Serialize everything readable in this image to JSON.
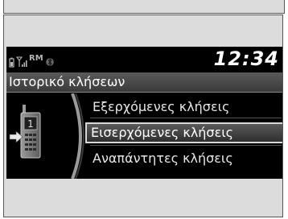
{
  "status": {
    "roaming_label": "RM",
    "clock": "12:34",
    "icons": [
      "battery-icon",
      "signal-icon",
      "bluetooth-icon"
    ]
  },
  "title": "Ιστορικό κλήσεων",
  "menu": {
    "items": [
      {
        "label": "Εξερχόμενες κλήσεις",
        "selected": false
      },
      {
        "label": "Εισερχόμενες κλήσεις",
        "selected": true
      },
      {
        "label": "Αναπάντητες κλήσεις",
        "selected": false
      }
    ]
  },
  "phone_icon": {
    "label": "1"
  }
}
